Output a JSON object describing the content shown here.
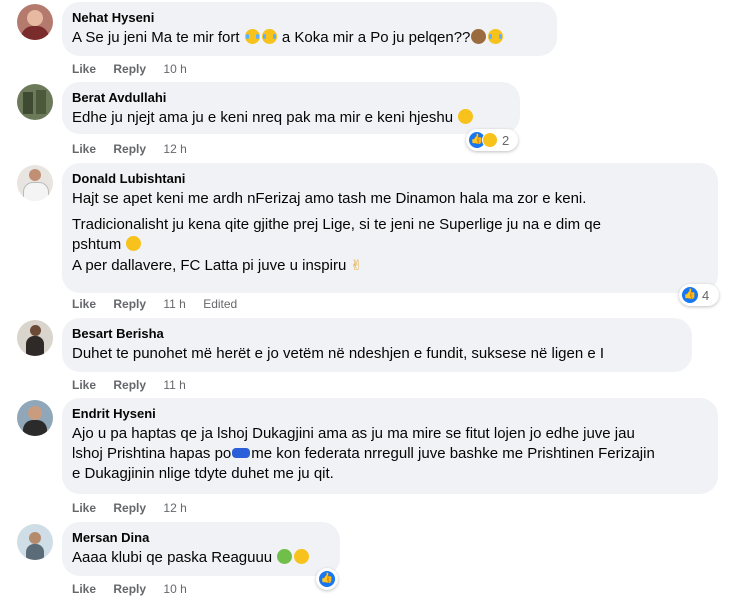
{
  "actions": {
    "like": "Like",
    "reply": "Reply",
    "edited": "Edited"
  },
  "comments": [
    {
      "author": "Nehat Hyseni",
      "lines": [
        "A Se ju jeni Ma te mir fort",
        "a Koka mir a Po ju pelqen??"
      ],
      "time": "10 h"
    },
    {
      "author": "Berat Avdullahi",
      "lines": [
        "Edhe ju njejt ama ju e keni nreq pak ma mir e keni hjeshu"
      ],
      "time": "12 h",
      "reaction_count": "2"
    },
    {
      "author": "Donald Lubishtani",
      "lines": [
        "Hajt se apet keni me ardh nFerizaj amo tash me Dinamon hala ma zor e keni.",
        "Tradicionalisht ju kena qite gjithe prej Lige, si te jeni ne Superlige ju na e dim qe",
        "pshtum",
        "A per dallavere, FC Latta pi juve u inspiru"
      ],
      "time": "11 h",
      "reaction_count": "4"
    },
    {
      "author": "Besart Berisha",
      "lines": [
        "Duhet te punohet më herët e jo vetëm në ndeshjen e fundit, suksese në ligen e I"
      ],
      "time": "11 h"
    },
    {
      "author": "Endrit Hyseni",
      "lines": [
        "Ajo u pa haptas qe ja lshoj Dukagjini ama as ju ma mire se fitut lojen jo edhe juve jau",
        "lshoj Prishtina hapas po",
        "me kon federata nrregull juve bashke me Prishtinen Ferizajin",
        "e Dukagjinin nlige tdyte duhet me ju qit."
      ],
      "time": "12 h"
    },
    {
      "author": "Mersan Dina",
      "lines": [
        "Aaaa klubi qe paska Reaguuu"
      ],
      "time": "10 h"
    }
  ]
}
